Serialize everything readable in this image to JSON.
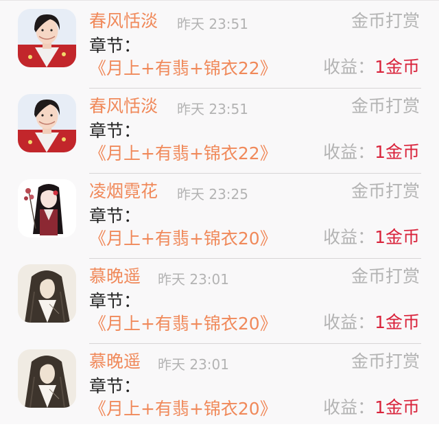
{
  "labels": {
    "chapter_prefix": "章节：",
    "income_prefix": "收益："
  },
  "records": [
    {
      "name": "春风恬淡",
      "time": "昨天 23:51",
      "reward_type": "金币打赏",
      "chapter": "《月上+有翡+锦衣22》",
      "income": "1金币",
      "avatar": "young-man-red-jacket"
    },
    {
      "name": "春风恬淡",
      "time": "昨天 23:51",
      "reward_type": "金币打赏",
      "chapter": "《月上+有翡+锦衣22》",
      "income": "1金币",
      "avatar": "young-man-red-jacket"
    },
    {
      "name": "凌烟霓花",
      "time": "昨天 23:25",
      "reward_type": "金币打赏",
      "chapter": "《月上+有翡+锦衣20》",
      "income": "1金币",
      "avatar": "anime-girl-with-flowers"
    },
    {
      "name": "慕晚遥",
      "time": "昨天 23:01",
      "reward_type": "金币打赏",
      "chapter": "《月上+有翡+锦衣20》",
      "income": "1金币",
      "avatar": "long-hair-man-illustration"
    },
    {
      "name": "慕晚遥",
      "time": "昨天 23:01",
      "reward_type": "金币打赏",
      "chapter": "《月上+有翡+锦衣20》",
      "income": "1金币",
      "avatar": "long-hair-man-illustration"
    }
  ],
  "colors": {
    "name": "#f0895a",
    "muted": "#b3b3b3",
    "income_value": "#d9233b",
    "divider": "#d7d5d6",
    "background": "#f9f8f9"
  }
}
